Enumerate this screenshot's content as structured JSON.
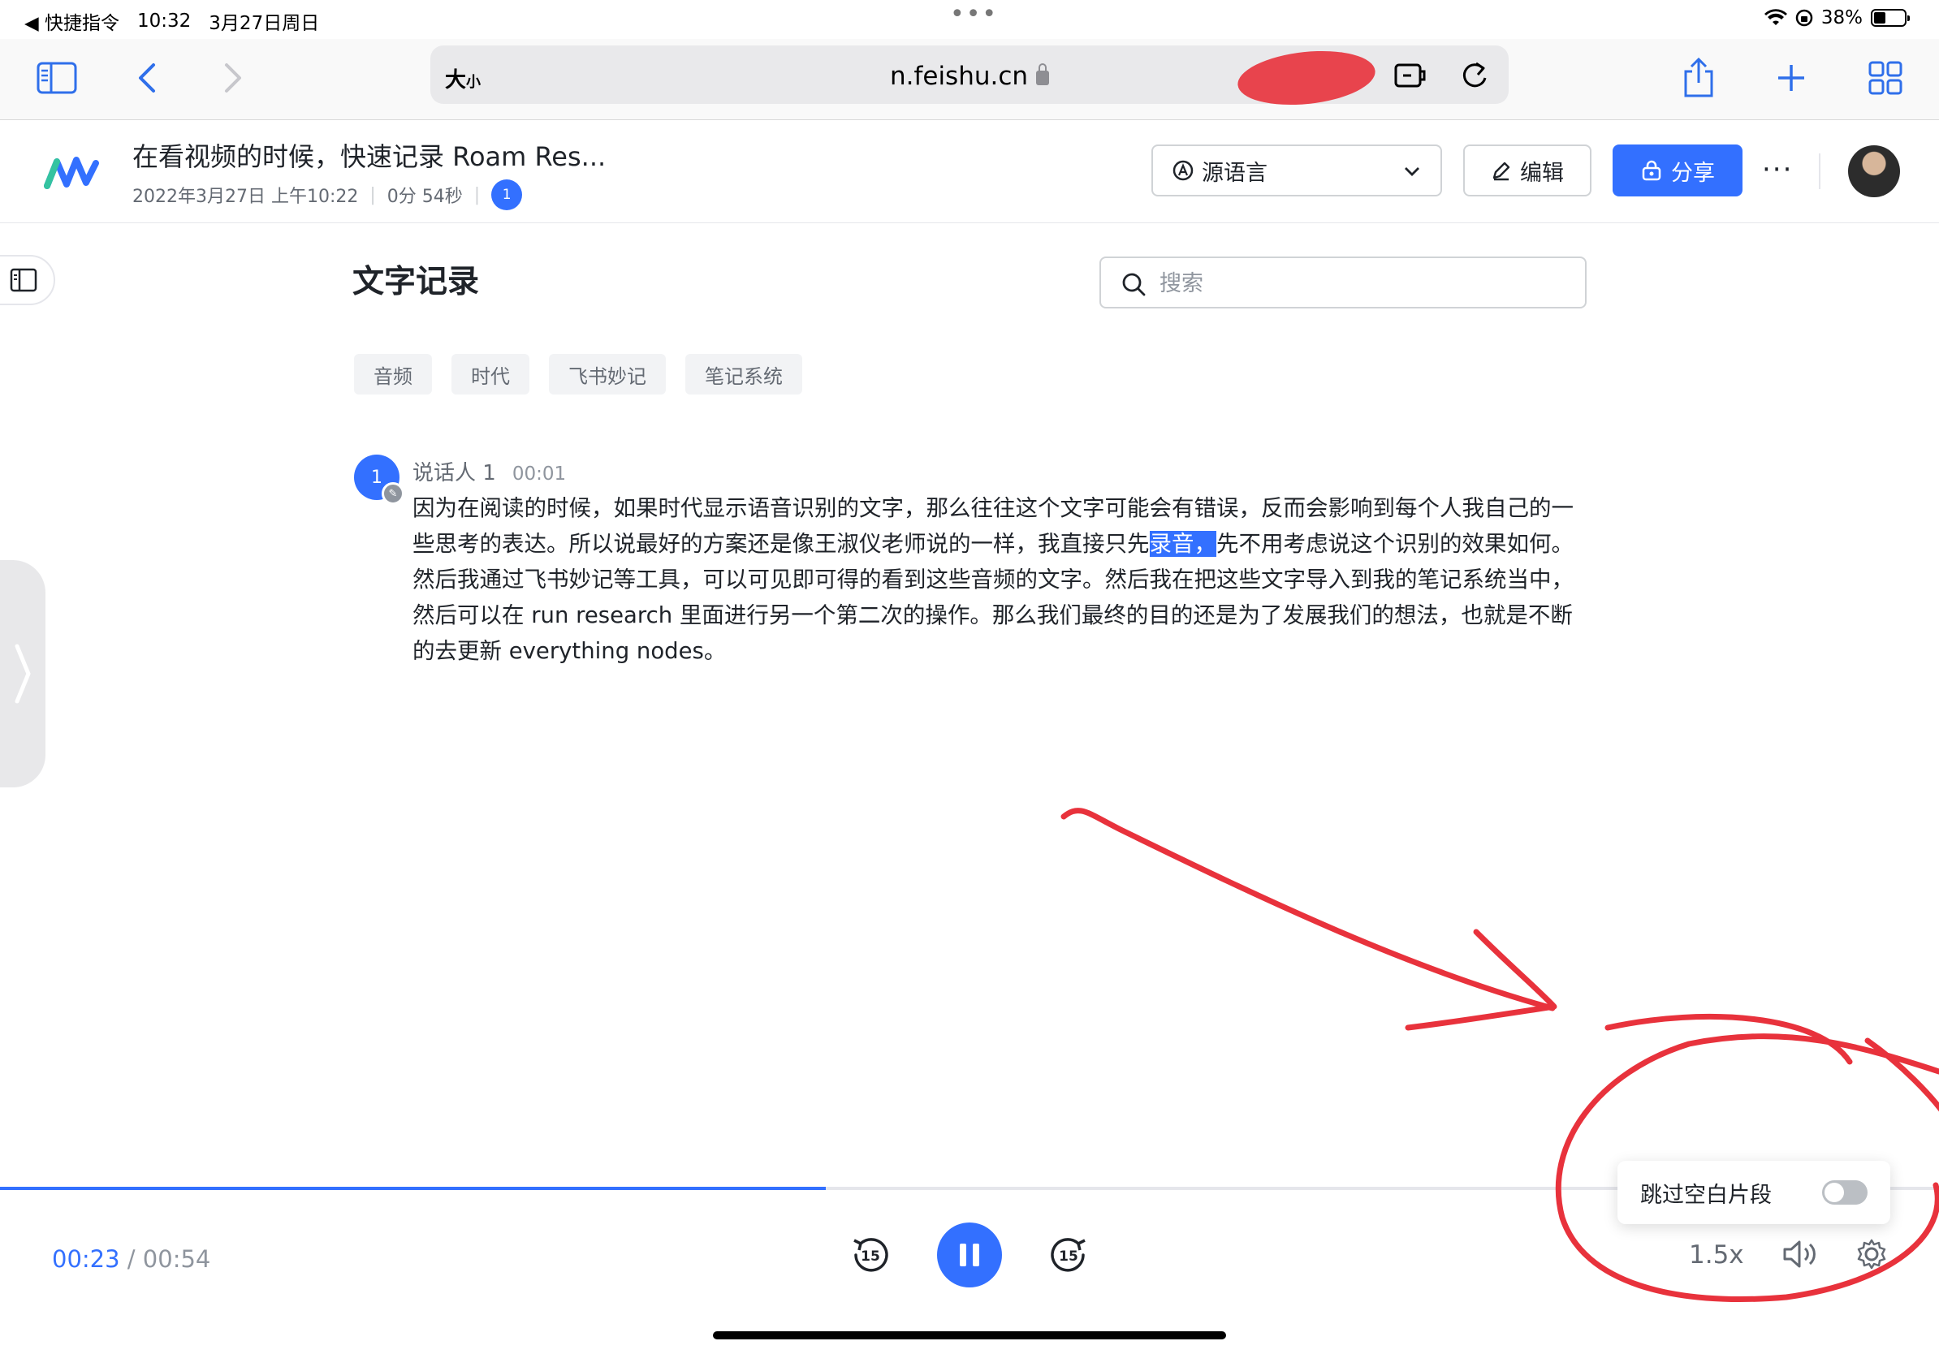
{
  "statusbar": {
    "back_app": "◀ 快捷指令",
    "time": "10:32",
    "date": "3月27日周日",
    "battery": "38%"
  },
  "safari": {
    "text_size": "大",
    "text_size_small": "小",
    "url": "n.feishu.cn"
  },
  "header": {
    "title": "在看视频的时候，快速记录 Roam Res...",
    "datetime": "2022年3月27日 上午10:22",
    "duration": "0分 54秒",
    "participants": "1",
    "language": "源语言",
    "edit_label": "编辑",
    "share_label": "分享",
    "more": "···"
  },
  "content": {
    "section_title": "文字记录",
    "search_placeholder": "搜索",
    "tags": [
      "音频",
      "时代",
      "飞书妙记",
      "笔记系统"
    ],
    "speaker": {
      "avatar": "1",
      "name": "说话人 1",
      "time": "00:01"
    },
    "transcript": {
      "before": "因为在阅读的时候，如果时代显示语音识别的文字，那么往往这个文字可能会有错误，反而会影响到每个人我自己的一些思考的表达。所以说最好的方案还是像王淑仪老师说的一样，我直接只先",
      "highlight": "录音，",
      "after": "先不用考虑说这个识别的效果如何。然后我通过飞书妙记等工具，可以可见即可得的看到这些音频的文字。然后我在把这些文字导入到我的笔记系统当中，然后可以在 run research 里面进行另一个第二次的操作。那么我们最终的目的还是为了发展我们的想法，也就是不断的去更新 everything nodes。"
    }
  },
  "player": {
    "current": "00:23",
    "separator": " / ",
    "total": "00:54",
    "progress_fraction": 0.4259,
    "rewind_label": "15",
    "forward_label": "15",
    "speed": "1.5x",
    "skip_silence_label": "跳过空白片段",
    "skip_silence_enabled": false
  },
  "colors": {
    "accent": "#3370ff",
    "annotation": "#e8323c"
  }
}
